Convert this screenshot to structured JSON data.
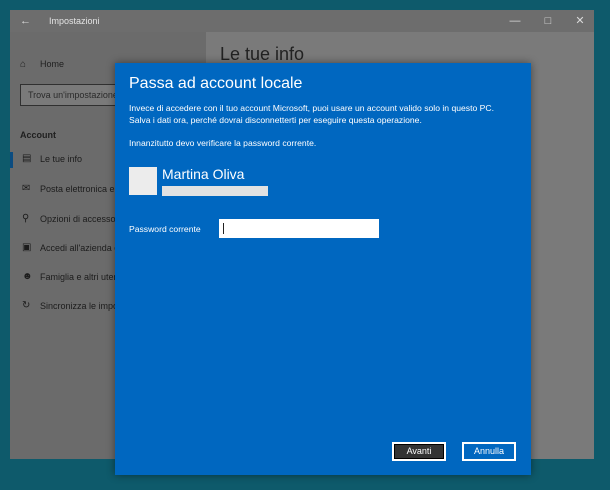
{
  "settings_window": {
    "title": "Impostazioni",
    "back_icon": "back-arrow-icon",
    "controls": [
      "minimize-icon",
      "maximize-icon",
      "close-icon"
    ],
    "heading": "Le tue info",
    "sidebar": {
      "home_label": "Home",
      "search_placeholder": "Trova un'impostazione",
      "section_label": "Account",
      "items": [
        {
          "label": "Le tue info",
          "icon": "person-card-icon",
          "selected": true
        },
        {
          "label": "Posta elettronica e a",
          "icon": "mail-icon"
        },
        {
          "label": "Opzioni di accesso",
          "icon": "key-icon"
        },
        {
          "label": "Accedi all'azienda o",
          "icon": "briefcase-icon"
        },
        {
          "label": "Famiglia e altri utent",
          "icon": "family-icon"
        },
        {
          "label": "Sincronizza le impos",
          "icon": "sync-icon"
        }
      ]
    }
  },
  "dialog": {
    "title": "Passa ad account locale",
    "description": "Invece di accedere con il tuo account Microsoft, puoi usare un account valido solo in questo PC. Salva i dati ora, perché dovrai disconnetterti per eseguire questa operazione.",
    "verify_note": "Innanzitutto devo verificare la password corrente.",
    "user_name": "Martina Oliva",
    "password_label": "Password corrente",
    "password_value": "",
    "next_label": "Avanti",
    "cancel_label": "Annulla",
    "accent_color": "#0067c0"
  }
}
